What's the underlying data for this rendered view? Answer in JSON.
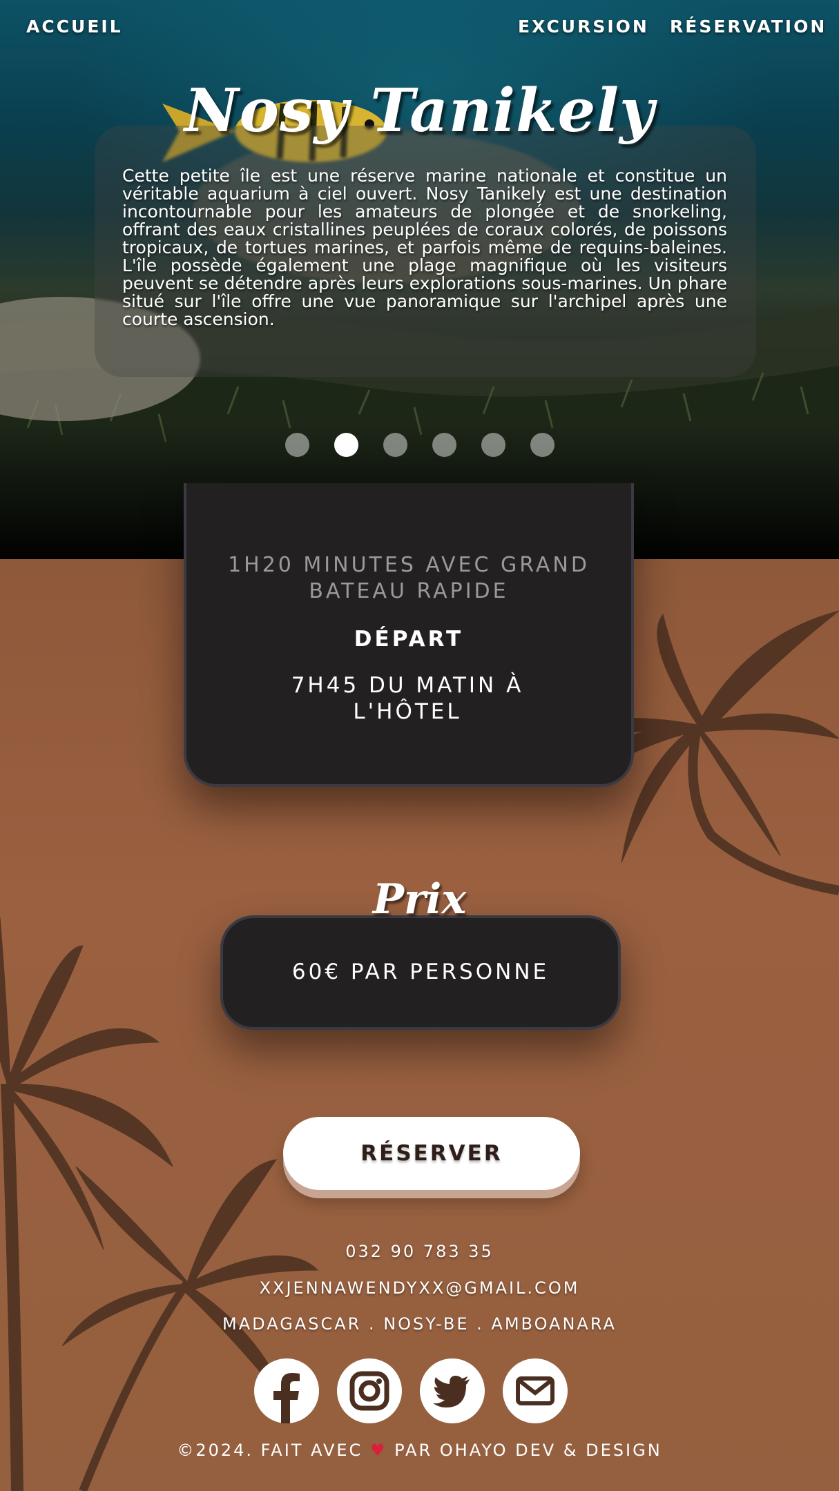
{
  "nav": {
    "home_label": "ACCUEIL",
    "excursion_label": "EXCURSION",
    "reservation_label": "RÉSERVATION"
  },
  "hero": {
    "title": "Nosy Tanikely",
    "description": "Cette petite île est une réserve marine nationale et constitue un véritable aquarium à ciel ouvert. Nosy Tanikely est une destination incontournable pour les amateurs de plongée et de snorkeling, offrant des eaux cristallines peuplées de coraux colorés, de poissons tropicaux, de tortues marines, et parfois même de requins-baleines. L'île possède également une plage magnifique où les visiteurs peuvent se détendre après leurs explorations sous-marines. Un phare situé sur l'île offre une vue panoramique sur l'archipel après une courte ascension.",
    "slide_count": 6,
    "active_slide": 2
  },
  "trip": {
    "duration_text": "1H20 MINUTES AVEC GRAND BATEAU RAPIDE",
    "departure_label": "DÉPART",
    "departure_value": "7H45 DU MATIN À L'HÔTEL"
  },
  "price": {
    "title": "Prix",
    "value": "60€ PAR PERSONNE"
  },
  "reserve_button": "RÉSERVER",
  "footer": {
    "phone": "032 90 783 35",
    "email": "XXJENNAWENDYXX@GMAIL.COM",
    "address": "MADAGASCAR . NOSY-BE . AMBOANARA",
    "socials": [
      "facebook-icon",
      "instagram-icon",
      "twitter-icon",
      "mail-icon"
    ],
    "copyright_before": "©2024. FAIT AVEC",
    "heart_icon": "heart-icon",
    "copyright_after": "PAR OHAYO DEV & DESIGN"
  },
  "colors": {
    "background_brown": "#95603f",
    "card_dark": "#232021",
    "card_border": "#3b3a42",
    "palm_silhouette": "#4a2f20",
    "heart": "#d8203c"
  }
}
